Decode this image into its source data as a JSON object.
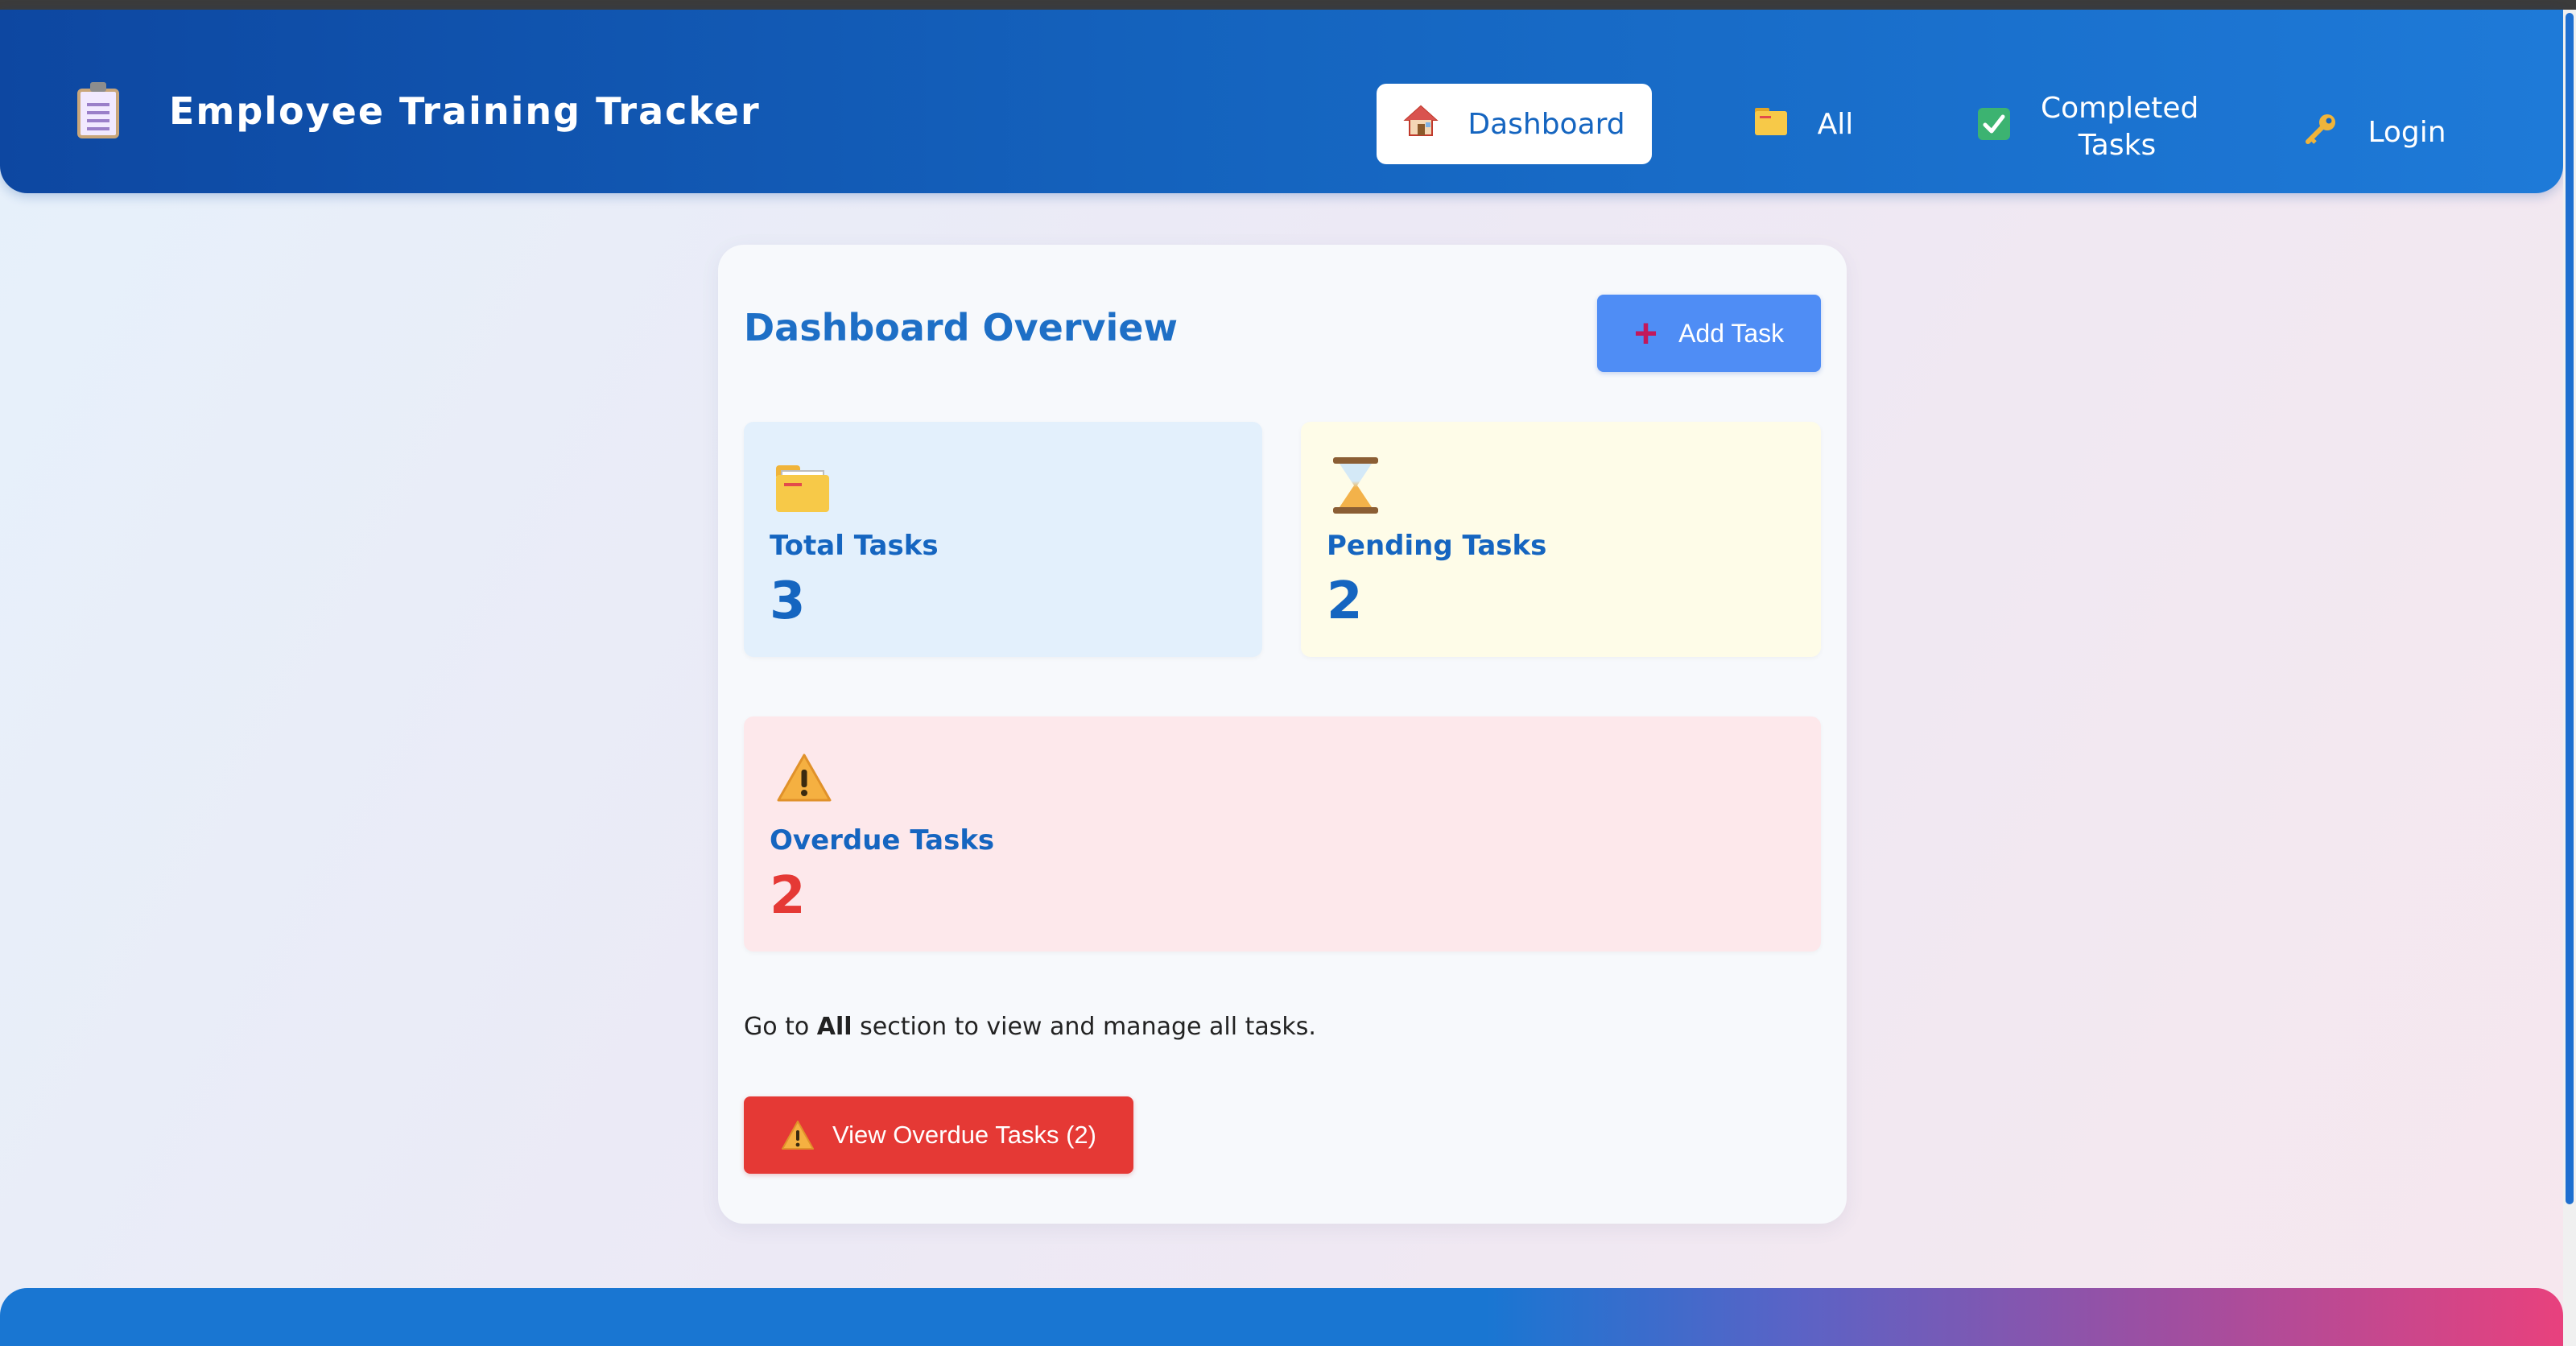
{
  "app": {
    "title": "Employee Training Tracker",
    "logo_icon": "clipboard-icon"
  },
  "nav": {
    "items": [
      {
        "label": "Dashboard",
        "icon": "house-icon",
        "active": true
      },
      {
        "label": "All",
        "icon": "folder-icon",
        "active": false
      },
      {
        "label": "Completed Tasks",
        "icon": "checkbox-icon",
        "active": false
      },
      {
        "label": "Login",
        "icon": "key-icon",
        "active": false
      }
    ]
  },
  "dashboard": {
    "title": "Dashboard Overview",
    "add_button": {
      "label": "Add Task",
      "icon": "plus-icon"
    },
    "stats": {
      "total": {
        "label": "Total Tasks",
        "value": "3",
        "icon": "folder-icon"
      },
      "pending": {
        "label": "Pending Tasks",
        "value": "2",
        "icon": "hourglass-icon"
      },
      "overdue": {
        "label": "Overdue Tasks",
        "value": "2",
        "icon": "warning-icon"
      }
    },
    "hint": {
      "prefix": "Go to ",
      "emphasis": "All",
      "suffix": " section to view and manage all tasks."
    },
    "overdue_button": {
      "label": "View Overdue Tasks (2)",
      "icon": "warning-icon"
    }
  },
  "colors": {
    "nav_start": "#0d47a1",
    "nav_end": "#1e7ad8",
    "accent": "#1565c0",
    "add_button": "#4f8df5",
    "danger": "#e53935",
    "total_card": "#e3f0fc",
    "pending_card": "#fefce8",
    "overdue_card": "#fde8eb"
  }
}
